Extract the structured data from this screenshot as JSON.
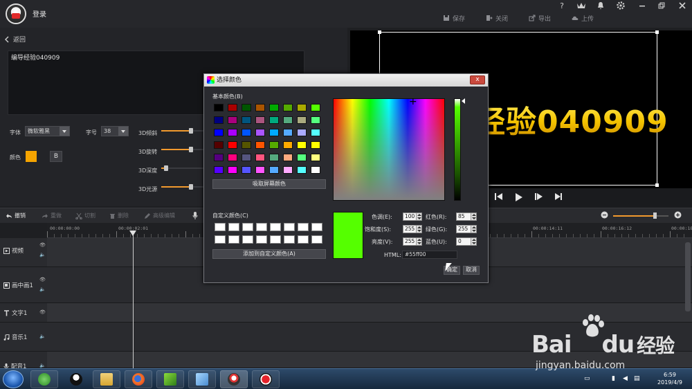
{
  "titlebar": {
    "login_label": "登录",
    "help_glyph": "?",
    "actions": [
      {
        "label": "保存",
        "icon": "save-icon"
      },
      {
        "label": "关闭",
        "icon": "exit-icon"
      },
      {
        "label": "导出",
        "icon": "export-icon"
      },
      {
        "label": "上传",
        "icon": "upload-icon"
      }
    ]
  },
  "editor": {
    "back_label": "返回",
    "text_value": "编导经验040909",
    "font_label": "字体",
    "font_value": "微软雅黑",
    "size_label": "字号",
    "size_value": "38",
    "color_label": "颜色",
    "bold_label": "B",
    "effects": [
      {
        "label": "3D倾斜",
        "level": 0.5
      },
      {
        "label": "3D旋转",
        "level": 0.5
      },
      {
        "label": "3D深度",
        "level": 0.1
      },
      {
        "label": "3D光源",
        "level": 0.5
      }
    ],
    "text_color": "#f5a400"
  },
  "preview": {
    "text": "经验040909"
  },
  "timeline": {
    "toolbar": [
      {
        "label": "撤销",
        "icon": "undo-icon",
        "enabled": true
      },
      {
        "label": "重做",
        "icon": "redo-icon",
        "enabled": false
      },
      {
        "label": "切割",
        "icon": "scissors-icon",
        "enabled": false
      },
      {
        "label": "删除",
        "icon": "trash-icon",
        "enabled": false
      },
      {
        "label": "高级编辑",
        "icon": "pencil-icon",
        "enabled": false
      }
    ],
    "ruler": [
      "00:00:00:00",
      "00:00:02:01",
      "00:00:14:11",
      "00:00:16:12",
      "00:00:18"
    ],
    "tracks": [
      {
        "label": "视频",
        "icon": "video-icon"
      },
      {
        "label": "画中画1",
        "icon": "pip-icon"
      },
      {
        "label": "文字1",
        "icon": "text-icon"
      },
      {
        "label": "音乐1",
        "icon": "music-icon"
      },
      {
        "label": "配音1",
        "icon": "mic-icon"
      }
    ]
  },
  "dialog": {
    "title": "选择颜色",
    "close_label": "x",
    "basic_label": "基本颜色(B)",
    "basic_colors": [
      "#000000",
      "#aa0000",
      "#005500",
      "#aa5500",
      "#00aa00",
      "#55aa00",
      "#aaaa00",
      "#55ff00",
      "#00007f",
      "#aa007f",
      "#00557f",
      "#aa557f",
      "#00aa7f",
      "#55aa7f",
      "#aaaa7f",
      "#55ff7f",
      "#0000ff",
      "#aa00ff",
      "#0055ff",
      "#aa55ff",
      "#00aaff",
      "#55aaff",
      "#aaaaff",
      "#55ffff",
      "#550000",
      "#ff0000",
      "#555500",
      "#ff5500",
      "#55aa00",
      "#ffaa00",
      "#ffff00",
      "#ffff00",
      "#55007f",
      "#ff007f",
      "#55557f",
      "#ff557f",
      "#55aa7f",
      "#ffaa7f",
      "#55ff7f",
      "#ffff7f",
      "#5500ff",
      "#ff00ff",
      "#5555ff",
      "#ff55ff",
      "#55aaff",
      "#ffaaff",
      "#55ffff",
      "#ffffff"
    ],
    "pick_screen_label": "吸取屏幕颜色",
    "custom_label": "自定义颜色(C)",
    "add_custom_label": "添加到自定义颜色(A)",
    "fields": {
      "hue_label": "色调(E):",
      "hue": "100",
      "sat_label": "饱和度(S):",
      "sat": "255",
      "val_label": "亮度(V):",
      "val": "255",
      "red_label": "红色(R):",
      "red": "85",
      "green_label": "绿色(G):",
      "green": "255",
      "blue_label": "蓝色(U):",
      "blue": "0"
    },
    "html_label": "HTML:",
    "html_value": "#55ff00",
    "ok_label": "确定",
    "cancel_label": "取消",
    "current_color": "#55ff00"
  },
  "taskbar": {
    "time": "6:59",
    "date": "2019/4/9"
  },
  "watermark": {
    "brand_left": "Bai",
    "brand_right": "du",
    "brand_cn": "经验",
    "url": "jingyan.baidu.com"
  }
}
